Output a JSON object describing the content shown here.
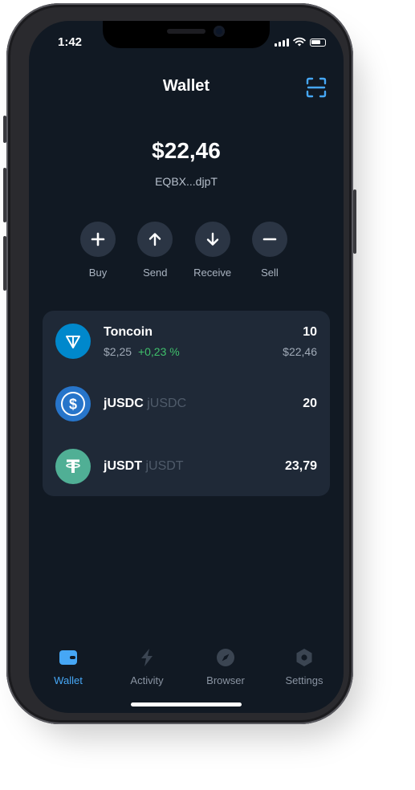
{
  "status": {
    "time": "1:42"
  },
  "header": {
    "title": "Wallet",
    "scan_icon": "scan-icon"
  },
  "wallet": {
    "balance": "$22,46",
    "address": "EQBX...djpT"
  },
  "actions": [
    {
      "label": "Buy",
      "icon": "plus-icon"
    },
    {
      "label": "Send",
      "icon": "arrow-up-icon"
    },
    {
      "label": "Receive",
      "icon": "arrow-down-icon"
    },
    {
      "label": "Sell",
      "icon": "minus-icon"
    }
  ],
  "tokens": [
    {
      "name": "Toncoin",
      "ticker": "",
      "price": "$2,25",
      "change": "+0,23 %",
      "amount": "10",
      "value": "$22,46",
      "icon": "toncoin-icon",
      "color": "#0088cc"
    },
    {
      "name": "jUSDC",
      "ticker": "jUSDC",
      "amount": "20",
      "icon": "usdc-icon",
      "color": "#2775ca"
    },
    {
      "name": "jUSDT",
      "ticker": "jUSDT",
      "amount": "23,79",
      "icon": "usdt-icon",
      "color": "#50af95"
    }
  ],
  "tabs": [
    {
      "label": "Wallet",
      "icon": "wallet-icon",
      "active": true
    },
    {
      "label": "Activity",
      "icon": "lightning-icon"
    },
    {
      "label": "Browser",
      "icon": "compass-icon"
    },
    {
      "label": "Settings",
      "icon": "settings-icon"
    }
  ],
  "colors": {
    "accent": "#46a7f5",
    "positive": "#3fbf6b",
    "background": "#111923",
    "card": "#1f2937"
  }
}
